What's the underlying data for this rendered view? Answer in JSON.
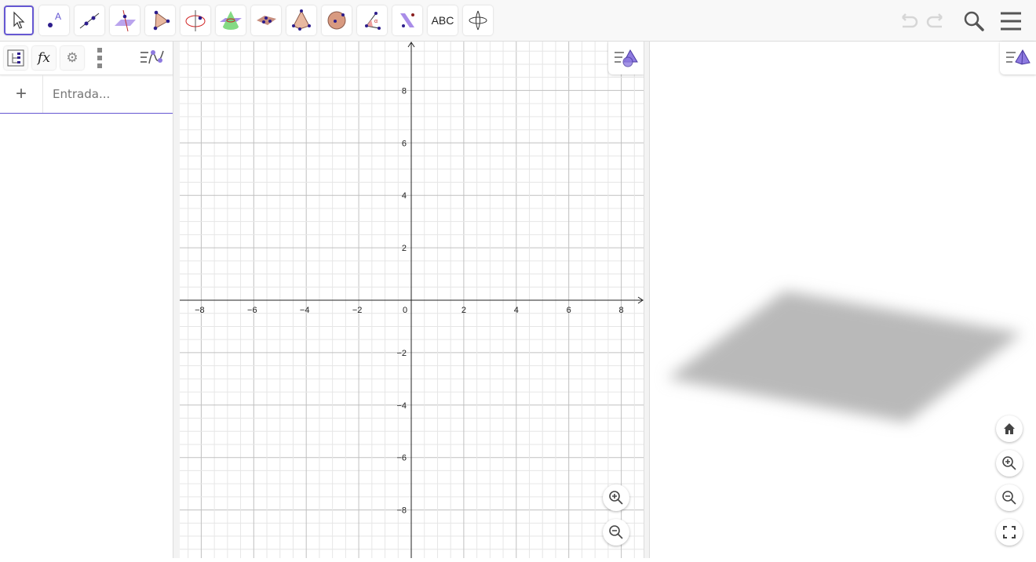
{
  "toolbar": {
    "tools": [
      {
        "name": "move-tool",
        "selected": true
      },
      {
        "name": "point-tool",
        "label": "A"
      },
      {
        "name": "line-tool"
      },
      {
        "name": "perpendicular-line-tool"
      },
      {
        "name": "polygon-tool"
      },
      {
        "name": "circle-axis-tool"
      },
      {
        "name": "intersect-surfaces-tool"
      },
      {
        "name": "plane-three-points-tool"
      },
      {
        "name": "pyramid-tool"
      },
      {
        "name": "sphere-tool"
      },
      {
        "name": "angle-tool",
        "label": "α"
      },
      {
        "name": "reflect-plane-tool"
      },
      {
        "name": "text-tool",
        "label": "ABC"
      },
      {
        "name": "rotate-view-tool"
      }
    ],
    "undo": "undo-icon",
    "redo": "redo-icon",
    "search": "search-icon",
    "menu": "menu-icon"
  },
  "algebra": {
    "fx_label": "fx",
    "input_placeholder": "Entrada...",
    "plus": "+"
  },
  "graphics": {
    "x_ticks": [
      "−8",
      "−6",
      "−4",
      "−2",
      "0",
      "2",
      "4",
      "6",
      "8"
    ],
    "x_values": [
      -8,
      -6,
      -4,
      -2,
      0,
      2,
      4,
      6,
      8
    ],
    "y_ticks": [
      "8",
      "6",
      "4",
      "2",
      "−2",
      "−4",
      "−6",
      "−8"
    ],
    "y_values": [
      8,
      6,
      4,
      2,
      -2,
      -4,
      -6,
      -8
    ],
    "xlim": [
      -8.9,
      8.75
    ],
    "ylim": [
      -9.85,
      9.85
    ]
  },
  "colors": {
    "accent": "#6557d2",
    "axis": "#222222",
    "grid_major": "#c0c0c0",
    "grid_minor": "#e6e6e6",
    "plane": "#b9b9b9"
  }
}
